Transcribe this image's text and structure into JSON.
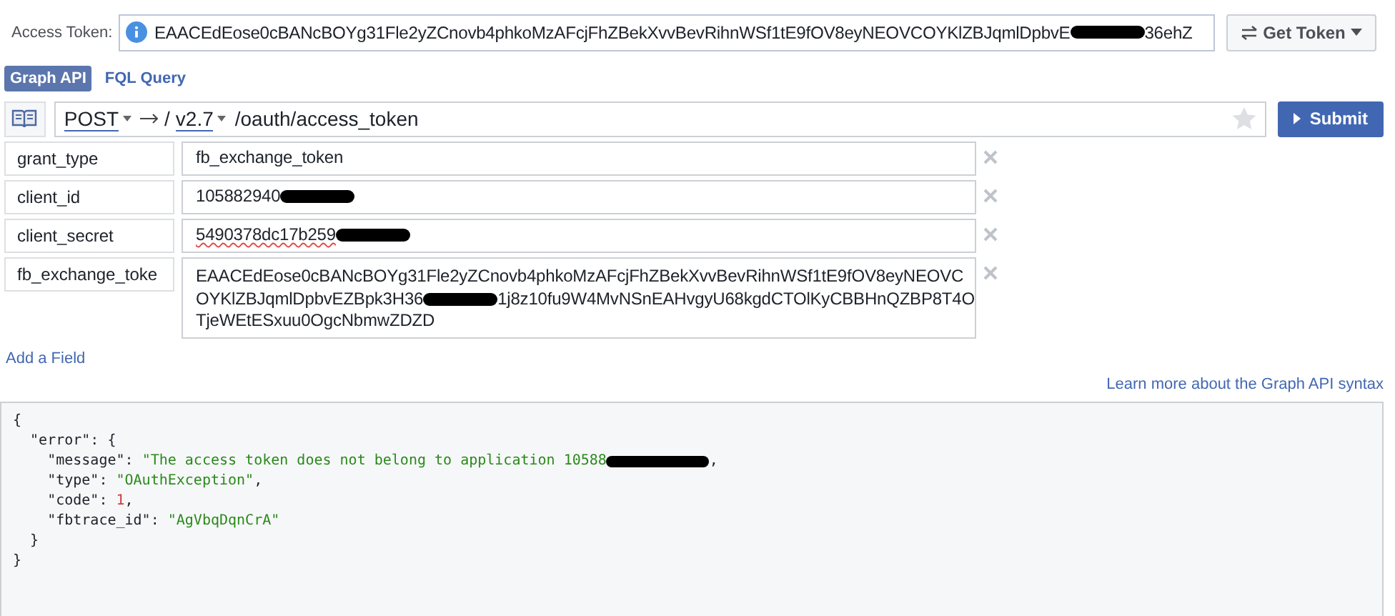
{
  "access_token": {
    "label": "Access Token:",
    "parts": [
      {
        "kind": "text",
        "text": "EAACEdEose0cBANcBOYg31Fle2yZCnovb4phkoMzAFcjFhZBekXvvBevRihnWSf1tE9fOV8eyNEOVCOYKlZBJqmlDpbvE"
      },
      {
        "kind": "redaction"
      },
      {
        "kind": "text",
        "text": "36ehZ"
      }
    ]
  },
  "get_token": {
    "label": "Get Token"
  },
  "tabs": [
    {
      "label": "Graph API",
      "selected": true
    },
    {
      "label": "FQL Query",
      "selected": false
    }
  ],
  "request": {
    "method": "POST",
    "separator": "/",
    "version": "v2.7",
    "path": "/oauth/access_token",
    "starred": false
  },
  "submit": {
    "label": "Submit"
  },
  "params": [
    {
      "name": "grant_type",
      "lines": [
        [
          {
            "kind": "text",
            "text": "fb_exchange_token"
          }
        ]
      ]
    },
    {
      "name": "client_id",
      "lines": [
        [
          {
            "kind": "text",
            "text": "105882940"
          },
          {
            "kind": "redaction"
          }
        ]
      ]
    },
    {
      "name": "client_secret",
      "lines": [
        [
          {
            "kind": "text",
            "text": "5490378dc17b259"
          },
          {
            "kind": "redaction"
          }
        ]
      ]
    },
    {
      "name": "fb_exchange_toke",
      "lines": [
        [
          {
            "kind": "text",
            "text": "EAACEdEose0cBANcBOYg31Fle2yZCnovb4phkoMzAFcjFhZBekXvvBevRihnWSf1tE9fOV8eyNEOVC"
          }
        ],
        [
          {
            "kind": "text",
            "text": "OYKlZBJqmlDpbvEZBpk3H36"
          },
          {
            "kind": "redaction"
          },
          {
            "kind": "text",
            "text": "1j8z10fu9W4MvNSnEAHvgyU68kgdCTOlKyCBBHnQZBP8T4O"
          }
        ],
        [
          {
            "kind": "text",
            "text": "TjeWEtESxuu0OgcNbmwZDZD"
          }
        ]
      ]
    }
  ],
  "add_field": "Add a Field",
  "learn_more": "Learn more about the Graph API syntax",
  "response": [
    [
      {
        "kind": "punct",
        "text": "{"
      }
    ],
    [
      {
        "kind": "punct",
        "text": "  \"error\": {"
      }
    ],
    [
      {
        "kind": "punct",
        "text": "    \"message\": "
      },
      {
        "kind": "string",
        "text": "\"The access token does not belong to application 10588"
      },
      {
        "kind": "redaction"
      },
      {
        "kind": "punct",
        "text": ","
      }
    ],
    [
      {
        "kind": "punct",
        "text": "    \"type\": "
      },
      {
        "kind": "string",
        "text": "\"OAuthException\""
      },
      {
        "kind": "punct",
        "text": ","
      }
    ],
    [
      {
        "kind": "punct",
        "text": "    \"code\": "
      },
      {
        "kind": "number",
        "text": "1"
      },
      {
        "kind": "punct",
        "text": ","
      }
    ],
    [
      {
        "kind": "punct",
        "text": "    \"fbtrace_id\": "
      },
      {
        "kind": "string",
        "text": "\"AgVbqDqnCrA\""
      }
    ],
    [
      {
        "kind": "punct",
        "text": "  }"
      }
    ],
    [
      {
        "kind": "punct",
        "text": "}"
      }
    ]
  ]
}
